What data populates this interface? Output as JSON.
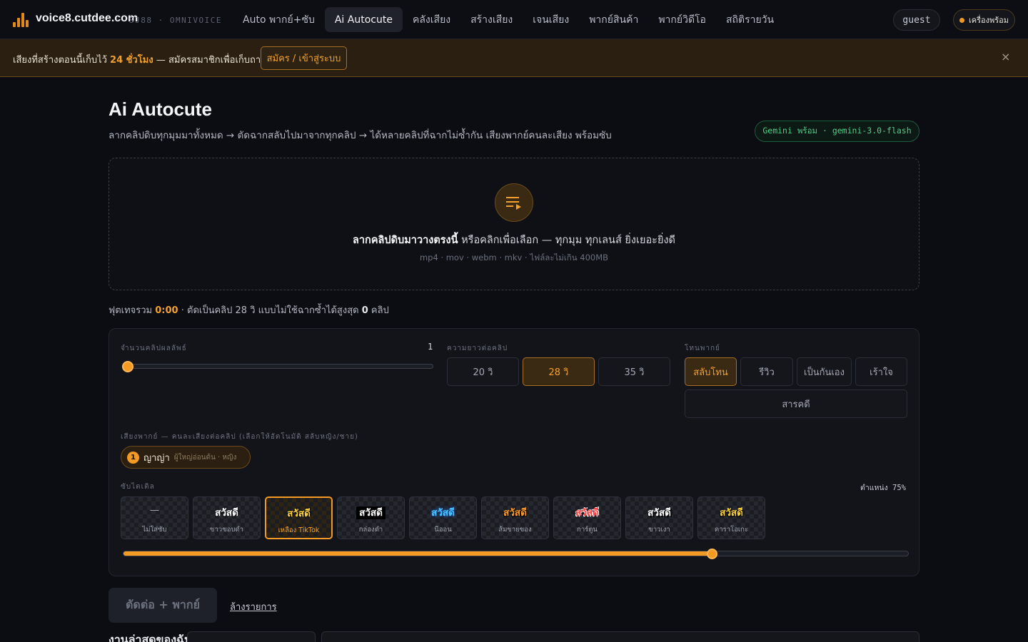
{
  "header": {
    "brand": "voice8.cutdee.com",
    "brand_sub": "SJ88 · OMNIVOICE",
    "nav": [
      {
        "label": "Auto พากย์+ซับ"
      },
      {
        "label": "Ai Autocute"
      },
      {
        "label": "คลังเสียง"
      },
      {
        "label": "สร้างเสียง"
      },
      {
        "label": "เจนเสียง"
      },
      {
        "label": "พากย์สินค้า"
      },
      {
        "label": "พากย์วิดีโอ"
      },
      {
        "label": "สถิติรายวัน"
      }
    ],
    "active_nav": "Ai Autocute",
    "user": "guest",
    "status": "เครื่องพร้อม"
  },
  "banner": {
    "text_before": "เสียงที่สร้างตอนนี้เก็บไว้ ",
    "highlight": "24 ชั่วโมง",
    "text_after": " — สมัครสมาชิกเพื่อเก็บถาวร",
    "button": "สมัคร / เข้าสู่ระบบ",
    "close": "×"
  },
  "page": {
    "title": "Ai Autocute",
    "subtitle": "ลากคลิปดิบทุกมุมมาทั้งหมด → ตัดฉากสลับไปมาจากทุกคลิป → ได้หลายคลิปที่ฉากไม่ซ้ำกัน เสียงพากย์คนละเสียง พร้อมซับ",
    "model_badge": "Gemini พร้อม · gemini-3.0-flash"
  },
  "dropzone": {
    "icon": "playlist-video-icon",
    "title_bold": "ลากคลิปดิบมาวางตรงนี้",
    "title_rest": " หรือคลิกเพื่อเลือก — ทุกมุม ทุกเลนส์ ยิ่งเยอะยิ่งดี",
    "formats": "mp4 · mov · webm · mkv · ไฟล์ละไม่เกิน 400MB"
  },
  "footage": {
    "prefix": "ฟุตเทจรวม ",
    "total": "0:00",
    "middle": " · ตัดเป็นคลิป 28 วิ แบบไม่ใช้ฉากซ้ำได้สูงสุด ",
    "max_clips": "0",
    "suffix": " คลิป"
  },
  "settings": {
    "count_label": "จำนวนคลิปผลลัพธ์",
    "count_value": "1",
    "count_fraction": 0,
    "length_label": "ความยาวต่อคลิป",
    "lengths": [
      "20 วิ",
      "28 วิ",
      "35 วิ"
    ],
    "selected_length": "28 วิ",
    "tone_label": "โทนพากย์",
    "tones": [
      "สลับโทน",
      "รีวิว",
      "เป็นกันเอง",
      "เร้าใจ",
      "สารคดี"
    ],
    "selected_tone": "สลับโทน",
    "voice_label": "เสียงพากย์ — คนละเสียงต่อคลิป (เลือกให้อัตโนมัติ สลับหญิง/ชาย)",
    "voices": [
      {
        "num": "1",
        "name": "ญาญ่า",
        "meta": "ผู้ใหญ่อ่อนต้น · หญิง"
      }
    ],
    "subtitle_label": "ซับไตเติล",
    "position_label": "ตำแหน่ง 75%",
    "position_fraction": 0.75,
    "sample_text": "สวัสดี",
    "styles": [
      {
        "name": "ไม่ใส่ซับ",
        "sample": "—",
        "variant": "none"
      },
      {
        "name": "ขาวขอบดำ",
        "sample": "สวัสดี",
        "variant": "white"
      },
      {
        "name": "เหลือง TikTok",
        "sample": "สวัสดี",
        "variant": "yellow"
      },
      {
        "name": "กล่องดำ",
        "sample": "สวัสดี",
        "variant": "box"
      },
      {
        "name": "นีออน",
        "sample": "สวัสดี",
        "variant": "neon"
      },
      {
        "name": "ส้มขายของ",
        "sample": "สวัสดี",
        "variant": "orange"
      },
      {
        "name": "การ์ตูน",
        "sample": "สวัสดี",
        "variant": "cartoon"
      },
      {
        "name": "ขาวเงา",
        "sample": "สวัสดี",
        "variant": "shadow"
      },
      {
        "name": "คาราโอเกะ",
        "sample": "สวัสดี",
        "variant": "karaoke"
      }
    ],
    "selected_style": "เหลือง TikTok"
  },
  "actions": {
    "run": "ตัดต่อ + พากย์",
    "clear": "ล้างรายการ"
  },
  "recent": {
    "title": "งานล่าสุดของฉัน"
  },
  "colors": {
    "accent": "#f29a23",
    "background": "#0b0d12",
    "success": "#4fd08a"
  }
}
